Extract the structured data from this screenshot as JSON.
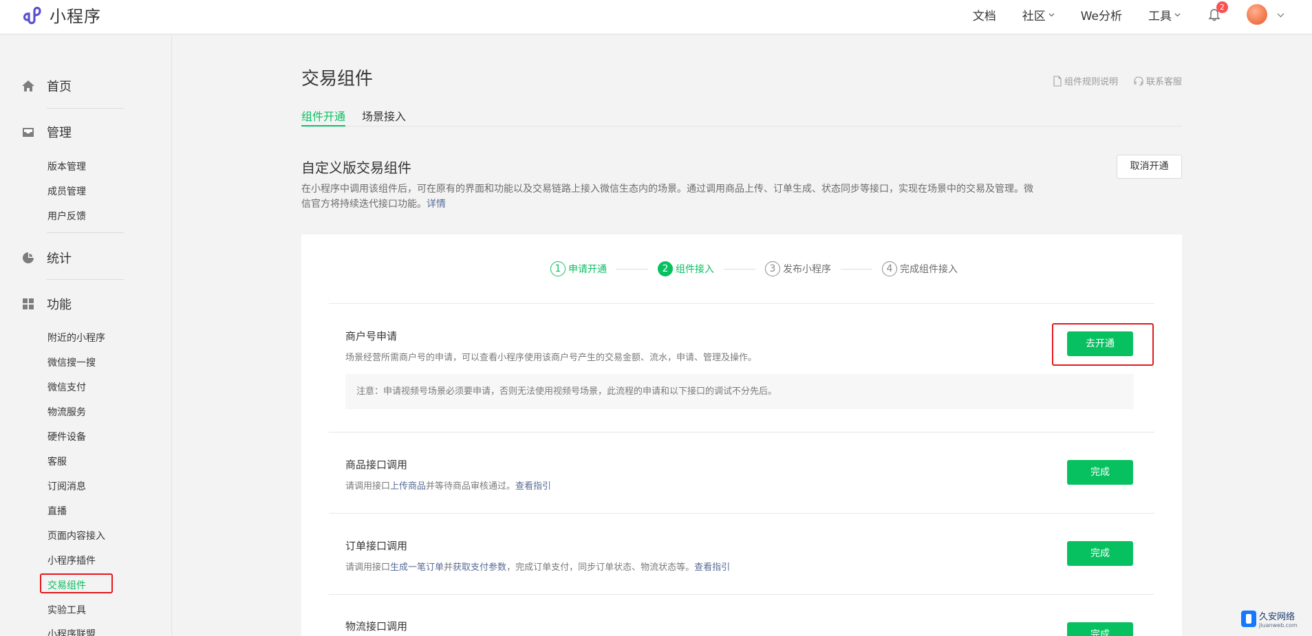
{
  "header": {
    "app_title": "小程序",
    "nav": [
      {
        "label": "文档"
      },
      {
        "label": "社区"
      },
      {
        "label": "We分析"
      },
      {
        "label": "工具"
      }
    ],
    "notification_count": "2"
  },
  "sidebar": {
    "sections": {
      "home": "首页",
      "manage": "管理",
      "stats": "统计",
      "features": "功能"
    },
    "manage_items": [
      "版本管理",
      "成员管理",
      "用户反馈"
    ],
    "feature_items": [
      "附近的小程序",
      "微信搜一搜",
      "微信支付",
      "物流服务",
      "硬件设备",
      "客服",
      "订阅消息",
      "直播",
      "页面内容接入",
      "小程序插件",
      "交易组件",
      "实验工具",
      "小程序联盟"
    ],
    "active_item": "交易组件"
  },
  "main": {
    "title": "交易组件",
    "help_links": {
      "rules": "组件规则说明",
      "service": "联系客服"
    },
    "tabs": [
      {
        "label": "组件开通"
      },
      {
        "label": "场景接入"
      }
    ],
    "section_title": "自定义版交易组件",
    "section_desc": "在小程序中调用该组件后，可在原有的界面和功能以及交易链路上接入微信生态内的场景。通过调用商品上传、订单生成、状态同步等接口，实现在场景中的交易及管理。微信官方将持续迭代接口功能。",
    "section_desc_link": "详情",
    "cancel_button": "取消开通",
    "steps": [
      {
        "num": "1",
        "label": "申请开通"
      },
      {
        "num": "2",
        "label": "组件接入"
      },
      {
        "num": "3",
        "label": "发布小程序"
      },
      {
        "num": "4",
        "label": "完成组件接入"
      }
    ],
    "items": {
      "merchant": {
        "title": "商户号申请",
        "desc": "场景经营所需商户号的申请，可以查看小程序使用该商户号产生的交易金额、流水，申请、管理及操作。",
        "notice": "注意：申请视频号场景必须要申请，否则无法使用视频号场景，此流程的申请和以下接口的调试不分先后。",
        "button": "去开通"
      },
      "product": {
        "title": "商品接口调用",
        "desc_pre": "请调用接口",
        "desc_link1": "上传商品",
        "desc_mid": "并等待商品审核通过。",
        "desc_link2": "查看指引",
        "button": "完成"
      },
      "order": {
        "title": "订单接口调用",
        "desc_pre": "请调用接口",
        "desc_link1": "生成一笔订单",
        "desc_mid1": "并",
        "desc_link2": "获取支付参数",
        "desc_mid2": "，完成订单支付，同步订单状态、物流状态等。",
        "desc_link3": "查看指引",
        "button": "完成"
      },
      "logistics": {
        "title": "物流接口调用",
        "button": "完成"
      }
    }
  },
  "watermark": {
    "name": "久安网络",
    "url": "Jiuanweb.com"
  },
  "colors": {
    "accent": "#07c160",
    "link": "#576b95",
    "highlight_box": "#e4161c",
    "badge": "#fa5151"
  }
}
